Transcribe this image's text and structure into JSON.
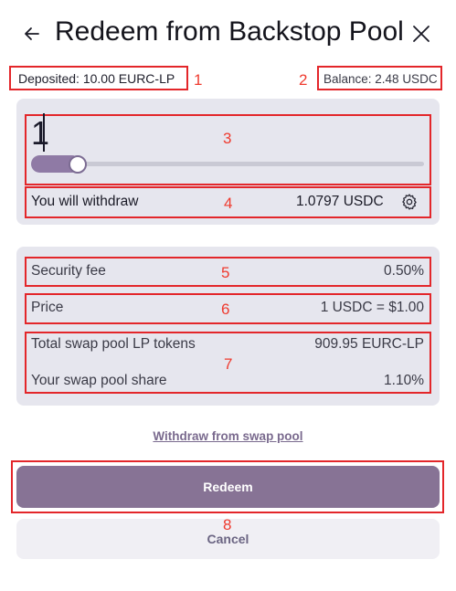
{
  "header": {
    "title": "Redeem from Backstop Pool"
  },
  "info": {
    "deposited": "Deposited: 10.00 EURC-LP",
    "balance": "Balance: 2.48 USDC"
  },
  "amount": {
    "value": "1",
    "slider_level_percent": 10
  },
  "withdraw": {
    "label": "You will withdraw",
    "value": "1.0797 USDC"
  },
  "details": {
    "security_fee_label": "Security fee",
    "security_fee_value": "0.50%",
    "price_label": "Price",
    "price_value": "1 USDC = $1.00",
    "total_lp_label": "Total swap pool LP tokens",
    "total_lp_value": "909.95 EURC-LP",
    "share_label": "Your swap pool share",
    "share_value": "1.10%"
  },
  "links": {
    "withdraw_from_swap_pool": "Withdraw from swap pool"
  },
  "buttons": {
    "redeem": "Redeem",
    "cancel": "Cancel"
  },
  "annotations": [
    "1",
    "2",
    "3",
    "4",
    "5",
    "6",
    "7",
    "8"
  ],
  "colors": {
    "annotation_red": "#e3262a",
    "primary_button": "#877395",
    "panel": "#e6e6ee",
    "slider_fill": "#8f7aa5"
  }
}
